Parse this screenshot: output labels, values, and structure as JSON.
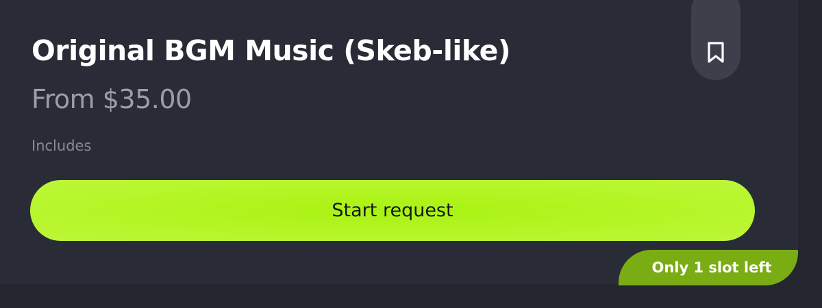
{
  "offer": {
    "title": "Original BGM Music (Skeb-like)",
    "price": "From $35.00",
    "includes_label": "Includes",
    "cta_label": "Start request",
    "slots_badge": "Only 1 slot left",
    "bookmark_icon": "bookmark-icon"
  },
  "colors": {
    "background": "#24252e",
    "card": "#292b37",
    "accent": "#b3f523",
    "badge": "#7aac14",
    "bookmark_button": "#3e3f4b"
  }
}
